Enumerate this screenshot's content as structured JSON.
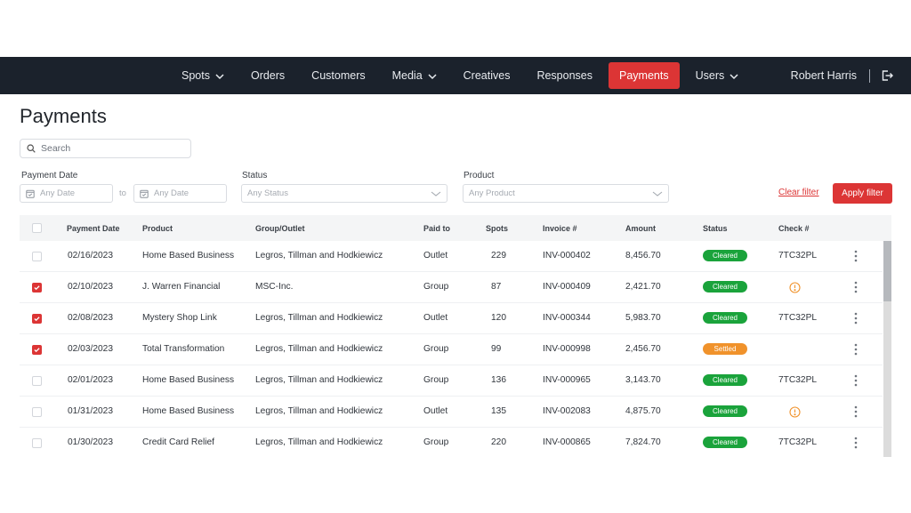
{
  "nav": {
    "items": [
      {
        "label": "Spots",
        "has_dropdown": true,
        "active": false
      },
      {
        "label": "Orders",
        "has_dropdown": false,
        "active": false
      },
      {
        "label": "Customers",
        "has_dropdown": false,
        "active": false
      },
      {
        "label": "Media",
        "has_dropdown": true,
        "active": false
      },
      {
        "label": "Creatives",
        "has_dropdown": false,
        "active": false
      },
      {
        "label": "Responses",
        "has_dropdown": false,
        "active": false
      },
      {
        "label": "Payments",
        "has_dropdown": false,
        "active": true
      },
      {
        "label": "Users",
        "has_dropdown": true,
        "active": false
      }
    ],
    "user_name": "Robert Harris",
    "logout_icon": "logout-icon"
  },
  "page": {
    "title": "Payments"
  },
  "search": {
    "placeholder": "Search",
    "value": ""
  },
  "filters": {
    "payment_date_label": "Payment Date",
    "date_from_placeholder": "Any Date",
    "to_label": "to",
    "date_to_placeholder": "Any Date",
    "status_label": "Status",
    "status_placeholder": "Any Status",
    "product_label": "Product",
    "product_placeholder": "Any Product",
    "clear_label": "Clear filter",
    "apply_label": "Apply filter"
  },
  "table": {
    "columns": [
      "Payment Date",
      "Product",
      "Group/Outlet",
      "Paid to",
      "Spots",
      "Invoice #",
      "Amount",
      "Status",
      "Check #"
    ],
    "rows": [
      {
        "checked": false,
        "date": "02/16/2023",
        "product": "Home Based Business",
        "group": "Legros, Tillman and Hodkiewicz",
        "paid_to": "Outlet",
        "spots": "229",
        "invoice": "INV-000402",
        "amount": "8,456.70",
        "status": "Cleared",
        "check": "7TC32PL",
        "check_warning": false
      },
      {
        "checked": true,
        "date": "02/10/2023",
        "product": "J. Warren Financial",
        "group": "MSC-Inc.",
        "paid_to": "Group",
        "spots": "87",
        "invoice": "INV-000409",
        "amount": "2,421.70",
        "status": "Cleared",
        "check": "",
        "check_warning": true
      },
      {
        "checked": true,
        "date": "02/08/2023",
        "product": "Mystery Shop Link",
        "group": "Legros, Tillman and Hodkiewicz",
        "paid_to": "Outlet",
        "spots": "120",
        "invoice": "INV-000344",
        "amount": "5,983.70",
        "status": "Cleared",
        "check": "7TC32PL",
        "check_warning": false
      },
      {
        "checked": true,
        "date": "02/03/2023",
        "product": "Total Transformation",
        "group": "Legros, Tillman and Hodkiewicz",
        "paid_to": "Group",
        "spots": "99",
        "invoice": "INV-000998",
        "amount": "2,456.70",
        "status": "Settled",
        "check": "",
        "check_warning": false
      },
      {
        "checked": false,
        "date": "02/01/2023",
        "product": "Home Based Business",
        "group": "Legros, Tillman and Hodkiewicz",
        "paid_to": "Group",
        "spots": "136",
        "invoice": "INV-000965",
        "amount": "3,143.70",
        "status": "Cleared",
        "check": "7TC32PL",
        "check_warning": false
      },
      {
        "checked": false,
        "date": "01/31/2023",
        "product": "Home Based Business",
        "group": "Legros, Tillman and Hodkiewicz",
        "paid_to": "Outlet",
        "spots": "135",
        "invoice": "INV-002083",
        "amount": "4,875.70",
        "status": "Cleared",
        "check": "",
        "check_warning": true
      },
      {
        "checked": false,
        "date": "01/30/2023",
        "product": "Credit Card Relief",
        "group": "Legros, Tillman and Hodkiewicz",
        "paid_to": "Group",
        "spots": "220",
        "invoice": "INV-000865",
        "amount": "7,824.70",
        "status": "Cleared",
        "check": "7TC32PL",
        "check_warning": false
      }
    ]
  },
  "colors": {
    "nav_bg": "#1b222c",
    "accent": "#dc3535",
    "cleared": "#1aa33b",
    "settled": "#f0922b",
    "warning": "#f0922b"
  }
}
